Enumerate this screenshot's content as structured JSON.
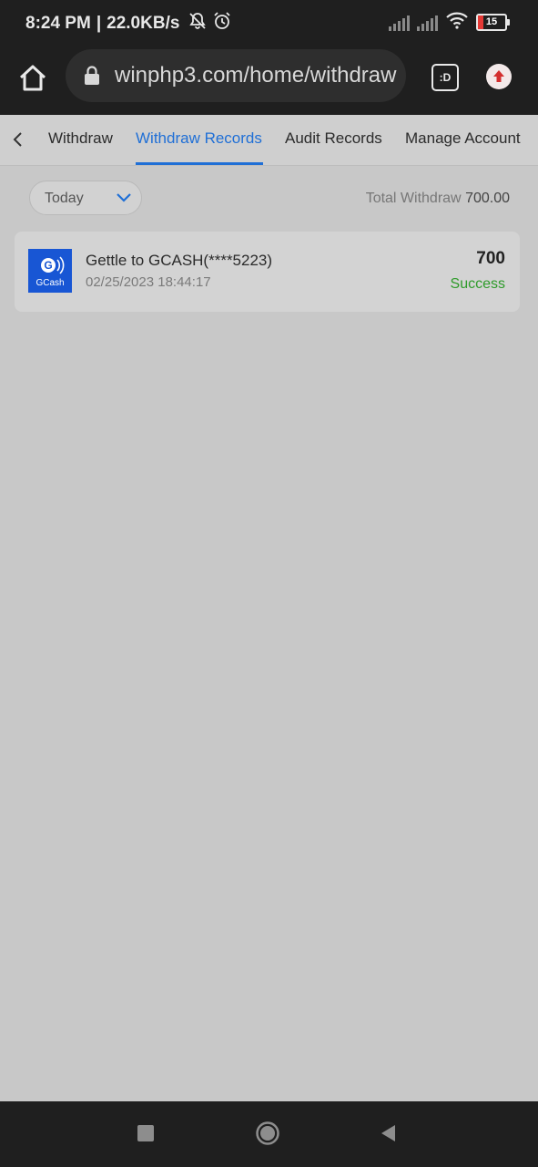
{
  "status_bar": {
    "time": "8:24 PM",
    "separator": "|",
    "network_speed": "22.0KB/s",
    "battery_level": "15",
    "icons": [
      "bell-off-icon",
      "alarm-icon",
      "signal-icon",
      "signal-icon",
      "wifi-icon",
      "battery-icon"
    ]
  },
  "browser": {
    "url": "winphp3.com/home/withdraw",
    "tab_switcher_label": ":D",
    "icons": [
      "home-icon",
      "lock-icon",
      "tab-switcher-icon",
      "update-icon"
    ]
  },
  "tabs": [
    {
      "label": "Withdraw",
      "active": false
    },
    {
      "label": "Withdraw Records",
      "active": true
    },
    {
      "label": "Audit Records",
      "active": false
    },
    {
      "label": "Manage Account",
      "active": false
    }
  ],
  "filter": {
    "selected": "Today",
    "total_label": "Total Withdraw",
    "total_value": "700.00"
  },
  "records": [
    {
      "logo_text": "GCash",
      "title": "Gettle to GCASH(****5223)",
      "timestamp": "02/25/2023 18:44:17",
      "amount": "700",
      "status": "Success"
    }
  ],
  "colors": {
    "accent": "#1f6fd6",
    "success": "#2e9b2a",
    "gcash_blue": "#1856d4",
    "chrome_dark": "#1f1f1f",
    "page_bg": "#c8c8c8"
  },
  "nav": {
    "icons": [
      "recent-apps-icon",
      "home-circle-icon",
      "back-triangle-icon"
    ]
  }
}
